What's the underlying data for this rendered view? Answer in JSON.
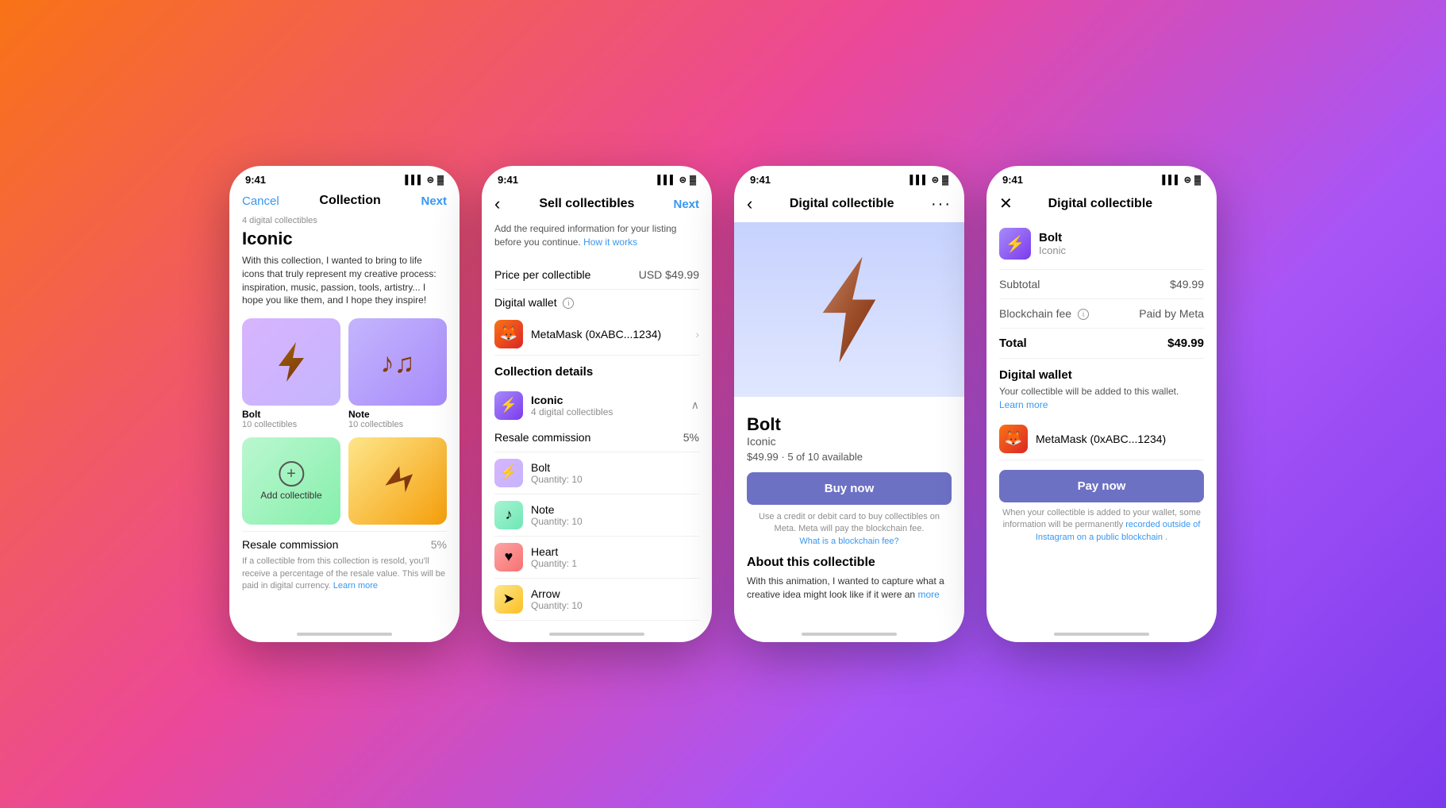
{
  "background": "linear-gradient(135deg, #f97316 0%, #ec4899 40%, #a855f7 70%, #7c3aed 100%)",
  "phone1": {
    "status_time": "9:41",
    "nav_cancel": "Cancel",
    "nav_title": "Collection",
    "nav_next": "Next",
    "badge": "4 digital collectibles",
    "title": "Iconic",
    "desc": "With this collection, I wanted to bring to life icons that truly represent my creative process: inspiration, music, passion, tools, artistry... I hope you like them, and I hope they inspire!",
    "cards": [
      {
        "name": "Bolt",
        "count": "10 collectibles",
        "bg": "#e8d5f5"
      },
      {
        "name": "Note",
        "count": "10 collectibles",
        "bg": "#e8d5f5"
      }
    ],
    "add_collectible": "Add collectible",
    "resale_label": "Resale commission",
    "resale_pct": "5%",
    "resale_desc": "If a collectible from this collection is resold, you'll receive a percentage of the resale value. This will be paid in digital currency.",
    "learn_more": "Learn more"
  },
  "phone2": {
    "status_time": "9:41",
    "nav_back": "‹",
    "nav_title": "Sell collectibles",
    "nav_next": "Next",
    "desc": "Add the required information for your listing before you continue.",
    "how_it_works": "How it works",
    "price_label": "Price per collectible",
    "price_value": "USD $49.99",
    "wallet_label": "Digital wallet",
    "wallet_name": "MetaMask (0xABC...1234)",
    "collection_section": "Collection details",
    "collection_name": "Iconic",
    "collection_count": "4 digital collectibles",
    "resale_label": "Resale commission",
    "resale_pct": "5%",
    "items": [
      {
        "name": "Bolt",
        "qty": "Quantity: 10",
        "bg": "#e8d5f5"
      },
      {
        "name": "Note",
        "qty": "Quantity: 10",
        "bg": "#d4f5e8"
      },
      {
        "name": "Heart",
        "qty": "Quantity: 1",
        "bg": "#fde8e8"
      },
      {
        "name": "Arrow",
        "qty": "Quantity: 10",
        "bg": "#fef3c7"
      }
    ]
  },
  "phone3": {
    "status_time": "9:41",
    "nav_back": "‹",
    "nav_title": "Digital collectible",
    "nav_more": "···",
    "name": "Bolt",
    "collection": "Iconic",
    "price_avail": "$49.99 · 5 of 10 available",
    "buy_btn": "Buy now",
    "buy_note1": "Use a credit or debit card to buy collectibles on Meta. Meta will pay the blockchain fee.",
    "blockchain_fee_link": "What is a blockchain fee?",
    "about_title": "About this collectible",
    "about_text": "With this animation, I wanted to capture what a creative idea might look like if it were an",
    "more_link": "more"
  },
  "phone4": {
    "status_time": "9:41",
    "nav_close": "✕",
    "nav_title": "Digital collectible",
    "item_name": "Bolt",
    "item_collection": "Iconic",
    "subtotal_label": "Subtotal",
    "subtotal_value": "$49.99",
    "fee_label": "Blockchain fee",
    "fee_value": "Paid by Meta",
    "total_label": "Total",
    "total_value": "$49.99",
    "wallet_section_title": "Digital wallet",
    "wallet_desc": "Your collectible will be added to this wallet.",
    "learn_more": "Learn more",
    "wallet_name": "MetaMask (0xABC...1234)",
    "pay_btn": "Pay now",
    "pay_note": "When your collectible is added to your wallet, some information will be permanently",
    "recorded_link": "recorded outside of Instagram on a public blockchain",
    "pay_note2": "."
  }
}
